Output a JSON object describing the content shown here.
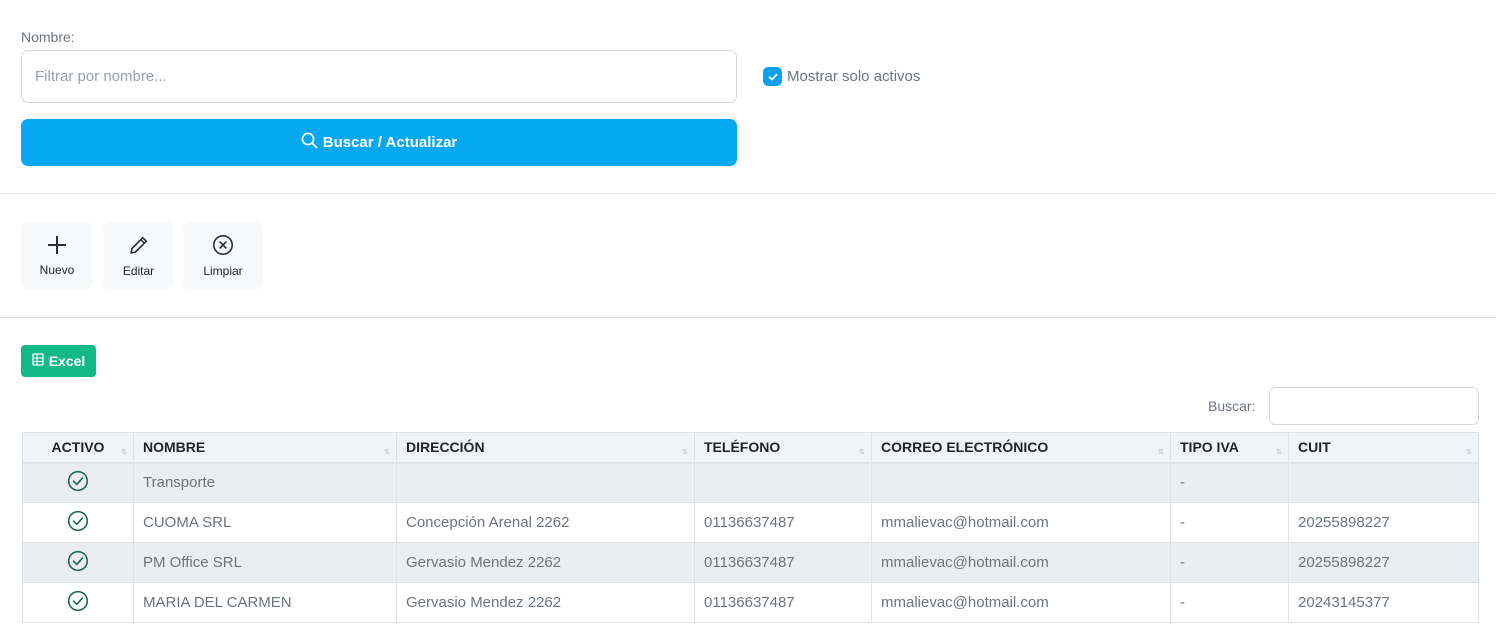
{
  "filter": {
    "name_label": "Nombre:",
    "name_value": "",
    "name_placeholder": "Filtrar por nombre...",
    "active_only_label": "Mostrar solo activos",
    "active_only_checked": true,
    "search_button": "Buscar / Actualizar"
  },
  "toolbar": {
    "new_label": "Nuevo",
    "edit_label": "Editar",
    "clear_label": "Limpiar"
  },
  "export": {
    "excel_label": "Excel"
  },
  "table": {
    "search_label": "Buscar:",
    "search_value": "",
    "columns": [
      "ACTIVO",
      "NOMBRE",
      "DIRECCIÓN",
      "TELÉFONO",
      "CORREO ELECTRÓNICO",
      "TIPO IVA",
      "CUIT"
    ],
    "rows": [
      {
        "active": true,
        "nombre": "Transporte",
        "direccion": "",
        "telefono": "",
        "correo": "",
        "tipo_iva": "-",
        "cuit": ""
      },
      {
        "active": true,
        "nombre": "CUOMA SRL",
        "direccion": "Concepción Arenal 2262",
        "telefono": "01136637487",
        "correo": "mmalievac@hotmail.com",
        "tipo_iva": "-",
        "cuit": "20255898227"
      },
      {
        "active": true,
        "nombre": "PM Office SRL",
        "direccion": "Gervasio Mendez 2262",
        "telefono": "01136637487",
        "correo": "mmalievac@hotmail.com",
        "tipo_iva": "-",
        "cuit": "20255898227"
      },
      {
        "active": true,
        "nombre": "MARIA DEL CARMEN",
        "direccion": "Gervasio Mendez 2262",
        "telefono": "01136637487",
        "correo": "mmalievac@hotmail.com",
        "tipo_iva": "-",
        "cuit": "20243145377"
      }
    ]
  },
  "colors": {
    "primary": "#06a8f2",
    "excel": "#12b886",
    "active_icon": "#1e6b52"
  }
}
